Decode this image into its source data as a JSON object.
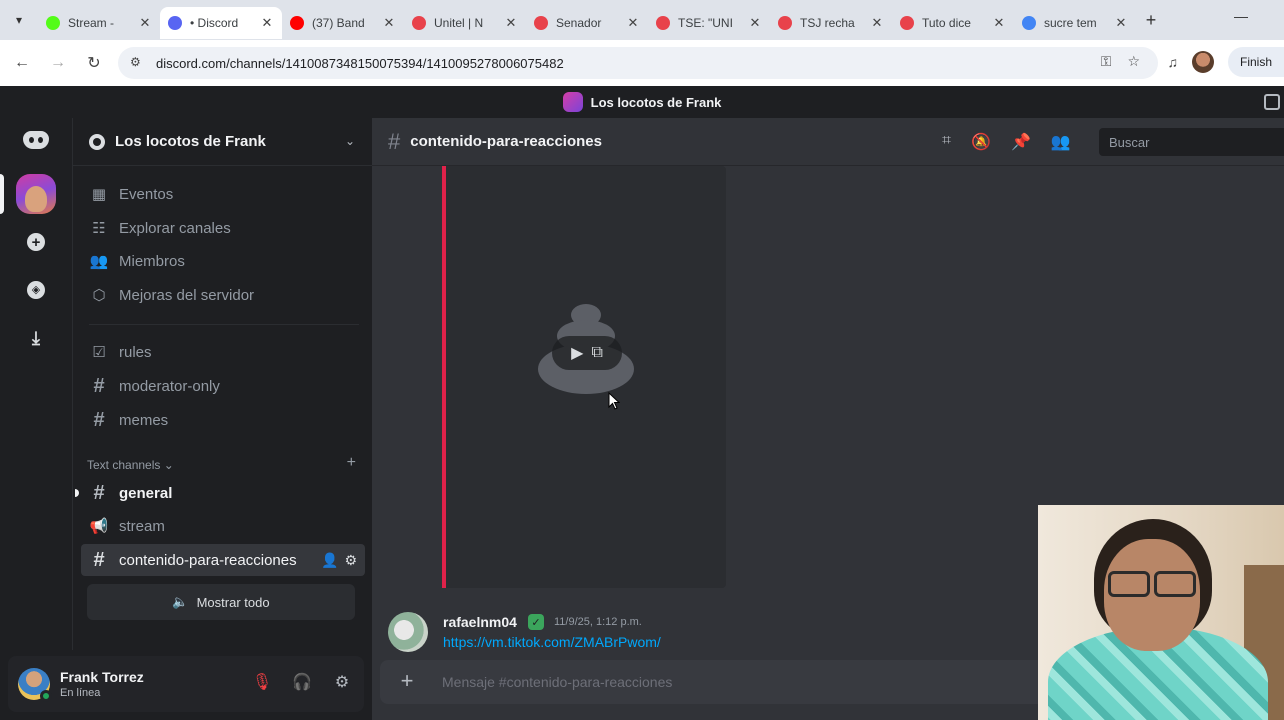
{
  "browser": {
    "tabs": [
      {
        "label": "Stream -",
        "color": "#53fc18"
      },
      {
        "label": "• Discord",
        "color": "#5865f2",
        "active": true
      },
      {
        "label": "(37) Band",
        "color": "#ff0000"
      },
      {
        "label": "Unitel | N",
        "color": "#e8424b"
      },
      {
        "label": "Senador",
        "color": "#e8424b"
      },
      {
        "label": "TSE: \"UNI",
        "color": "#e8424b"
      },
      {
        "label": "TSJ recha",
        "color": "#e8424b"
      },
      {
        "label": "Tuto dice",
        "color": "#e8424b"
      },
      {
        "label": "sucre tem",
        "color": "#4285f4"
      }
    ],
    "url": "discord.com/channels/1410087348150075394/1410095278006075482",
    "finish_label": "Finish"
  },
  "discord": {
    "window_title": "Los locotos de Frank",
    "server_name": "Los locotos de Frank",
    "nav": {
      "events": "Eventos",
      "browse": "Explorar canales",
      "members": "Miembros",
      "boosts": "Mejoras del servidor"
    },
    "channels_top": [
      {
        "name": "rules",
        "type": "rules"
      },
      {
        "name": "moderator-only",
        "type": "text"
      },
      {
        "name": "memes",
        "type": "text"
      }
    ],
    "category": "Text channels",
    "channels_text": [
      {
        "name": "general",
        "type": "text",
        "unread": true
      },
      {
        "name": "stream",
        "type": "announcement"
      },
      {
        "name": "contenido-para-reacciones",
        "type": "text",
        "selected": true
      }
    ],
    "show_all": "Mostrar todo",
    "user": {
      "name": "Frank Torrez",
      "status": "En línea"
    },
    "current_channel": "contenido-para-reacciones",
    "search_placeholder": "Buscar",
    "message": {
      "author": "rafaelnm04",
      "timestamp": "11/9/25, 1:12 p.m.",
      "link": "https://vm.tiktok.com/ZMABrPwom/"
    },
    "composer_placeholder": "Mensaje #contenido-para-reacciones",
    "accent": "#e0224a"
  }
}
